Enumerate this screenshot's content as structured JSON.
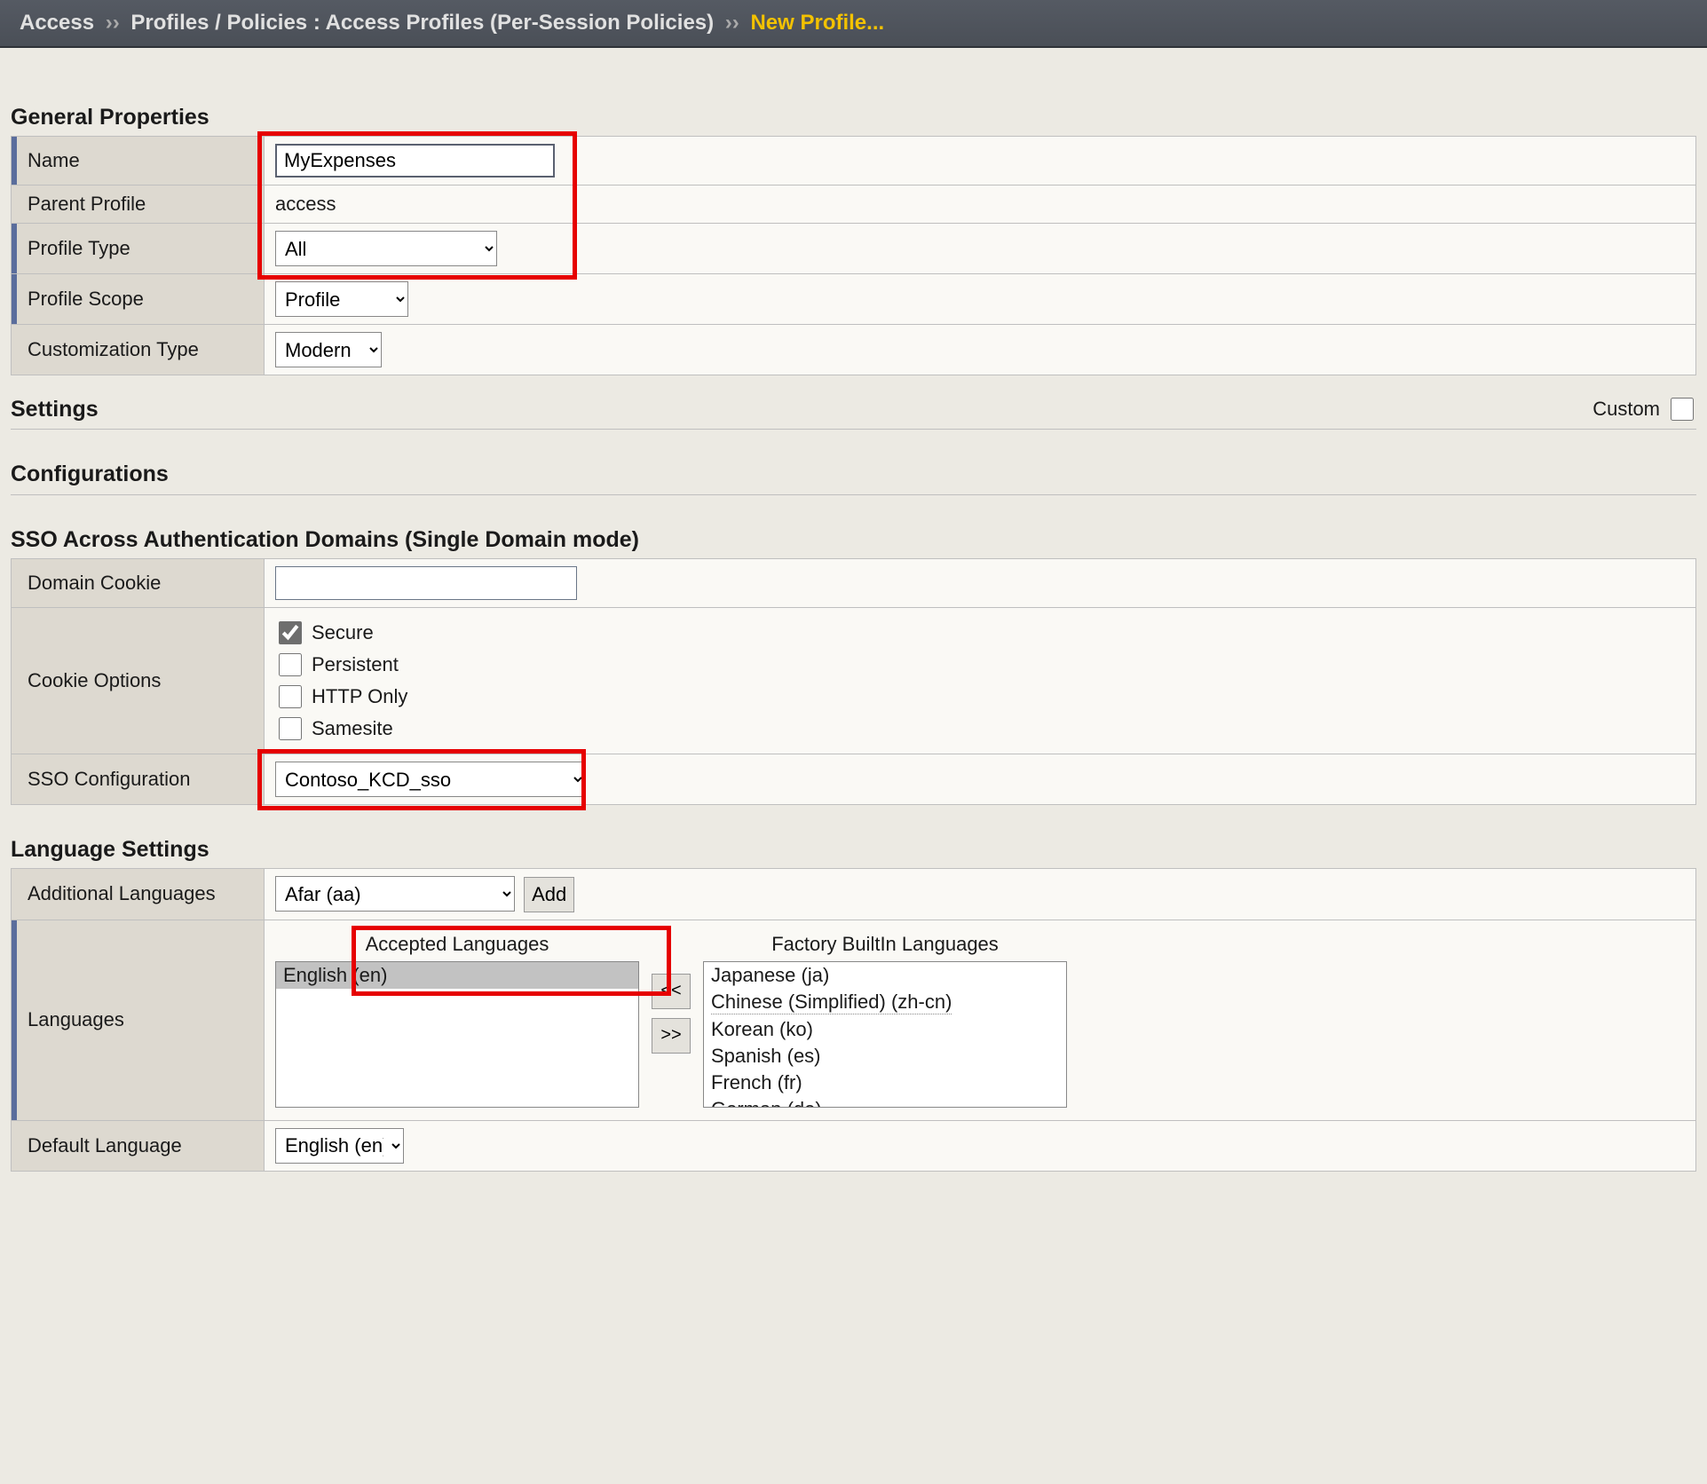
{
  "breadcrumb": {
    "root": "Access",
    "sep": "››",
    "mid": "Profiles / Policies : Access Profiles (Per-Session Policies)",
    "current": "New Profile..."
  },
  "sections": {
    "general": "General Properties",
    "settings": "Settings",
    "custom_label": "Custom",
    "configurations": "Configurations",
    "sso_domains": "SSO Across Authentication Domains (Single Domain mode)",
    "language": "Language Settings"
  },
  "general": {
    "name_label": "Name",
    "name_value": "MyExpenses",
    "parent_profile_label": "Parent Profile",
    "parent_profile_value": "access",
    "profile_type_label": "Profile Type",
    "profile_type_value": "All",
    "profile_scope_label": "Profile Scope",
    "profile_scope_value": "Profile",
    "customization_type_label": "Customization Type",
    "customization_type_value": "Modern"
  },
  "sso": {
    "domain_cookie_label": "Domain Cookie",
    "domain_cookie_value": "",
    "cookie_options_label": "Cookie Options",
    "opt_secure": "Secure",
    "opt_persistent": "Persistent",
    "opt_httponly": "HTTP Only",
    "opt_samesite": "Samesite",
    "secure_checked": true,
    "sso_config_label": "SSO Configuration",
    "sso_config_value": "Contoso_KCD_sso"
  },
  "lang": {
    "additional_label": "Additional Languages",
    "additional_value": "Afar (aa)",
    "add_btn": "Add",
    "languages_label": "Languages",
    "accepted_title": "Accepted Languages",
    "factory_title": "Factory BuiltIn Languages",
    "move_left": "<<",
    "move_right": ">>",
    "accepted_items": [
      "English (en)"
    ],
    "factory_items": [
      "Japanese (ja)",
      "Chinese (Simplified) (zh-cn)",
      "Korean (ko)",
      "Spanish (es)",
      "French (fr)",
      "German (de)"
    ],
    "default_label": "Default Language",
    "default_value": "English (en)"
  }
}
